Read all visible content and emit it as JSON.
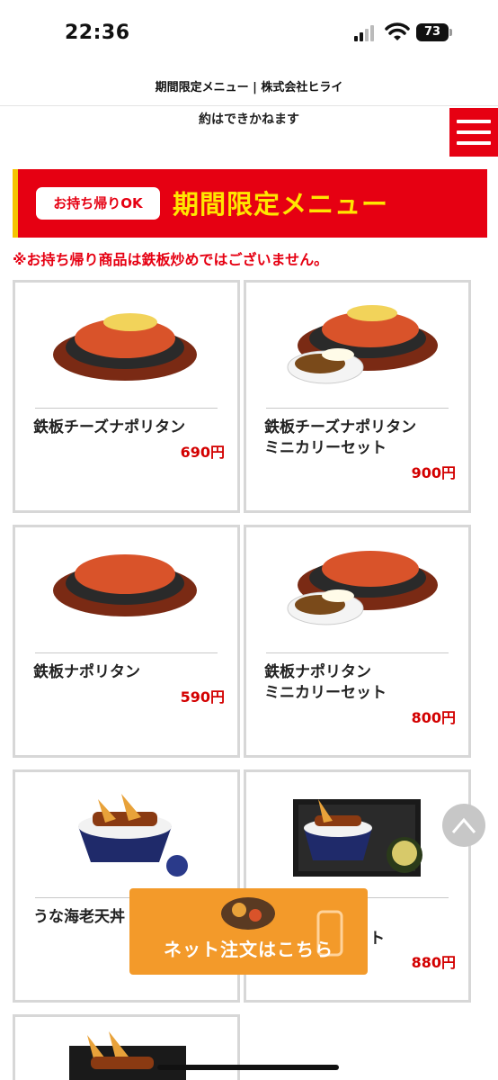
{
  "status_bar": {
    "time": "22:36",
    "battery": "73"
  },
  "page": {
    "title": "期間限定メニュー | 株式会社ヒライ",
    "notice_text": "約はできかねます"
  },
  "banner": {
    "takeout_badge": "お持ち帰りOK",
    "title": "期間限定メニュー",
    "takeout_note": "※お持ち帰り商品は鉄板炒めではございません。"
  },
  "menu_items": [
    {
      "name": "鉄板チーズナポリタン",
      "price": "690円",
      "image": "teppan-cheese-napolitan"
    },
    {
      "name": "鉄板チーズナポリタン\nミニカリーセット",
      "price": "900円",
      "image": "teppan-cheese-napolitan-curry-set"
    },
    {
      "name": "鉄板ナポリタン",
      "price": "590円",
      "image": "teppan-napolitan"
    },
    {
      "name": "鉄板ナポリタン\nミニカリーセット",
      "price": "800円",
      "image": "teppan-napolitan-curry-set"
    },
    {
      "name": "うな海老天丼",
      "price": "",
      "image": "una-ebi-tendon"
    },
    {
      "name": "ット",
      "price": "880円",
      "image": "una-ebi-tendon-set"
    }
  ],
  "float_order": {
    "label": "ネット注文はこちら"
  },
  "colors": {
    "brand_red": "#e60012",
    "accent_yellow": "#ffe600",
    "order_orange": "#f39a2a",
    "price_red": "#d30000"
  },
  "icons": {
    "menu": "hamburger-icon",
    "scroll_top": "chevron-up-icon"
  }
}
